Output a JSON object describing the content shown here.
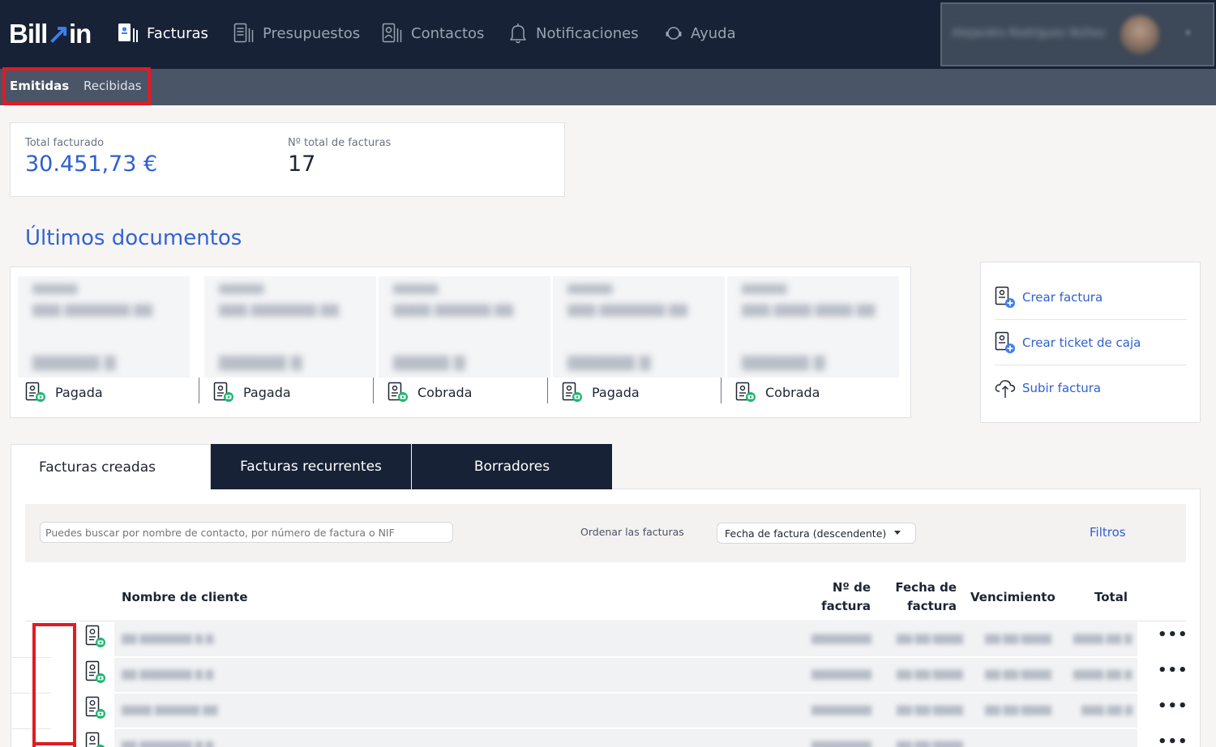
{
  "brand": {
    "name_a": "Bill",
    "name_b": "in"
  },
  "nav": {
    "items": [
      {
        "label": "Facturas",
        "icon": "invoice-icon",
        "active": true
      },
      {
        "label": "Presupuestos",
        "icon": "budget-icon",
        "active": false
      },
      {
        "label": "Contactos",
        "icon": "contacts-icon",
        "active": false
      },
      {
        "label": "Notificaciones",
        "icon": "bell-icon",
        "active": false
      },
      {
        "label": "Ayuda",
        "icon": "help-icon",
        "active": false
      }
    ]
  },
  "user": {
    "name": "Alejandro Rodríguez Núñez"
  },
  "subnav": {
    "emitidas": "Emitidas",
    "recibidas": "Recibidas"
  },
  "summary": {
    "total_label": "Total facturado",
    "total_value": "30.451,73 €",
    "count_label": "Nº total de facturas",
    "count_value": "17"
  },
  "last_docs": {
    "title": "Últimos documentos",
    "items": [
      {
        "status": "Pagada"
      },
      {
        "status": "Pagada"
      },
      {
        "status": "Cobrada"
      },
      {
        "status": "Pagada"
      },
      {
        "status": "Cobrada"
      }
    ]
  },
  "actions": {
    "create_invoice": "Crear factura",
    "create_ticket": "Crear ticket de caja",
    "upload_invoice": "Subir factura"
  },
  "tabs": {
    "created": "Facturas creadas",
    "recurring": "Facturas recurrentes",
    "drafts": "Borradores"
  },
  "filters": {
    "search_placeholder": "Puedes buscar por nombre de contacto, por número de factura o NIF",
    "order_label": "Ordenar las facturas",
    "order_value": "Fecha de factura (descendente)",
    "filters_link": "Filtros"
  },
  "table": {
    "headers": {
      "client": "Nombre de cliente",
      "number_1": "Nº de",
      "number_2": "factura",
      "date_1": "Fecha de",
      "date_2": "factura",
      "due": "Vencimiento",
      "total": "Total"
    },
    "row_actions": "•••"
  },
  "colors": {
    "nav_bg": "#172236",
    "subnav_bg": "#4a5568",
    "accent": "#2f5fd0",
    "highlight_red": "#e01b24",
    "status_green": "#1bb76e"
  }
}
